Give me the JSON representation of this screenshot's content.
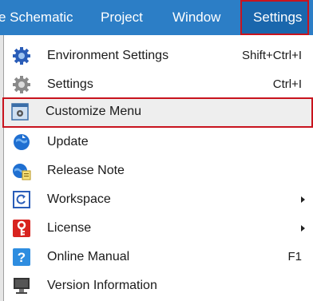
{
  "menubar": {
    "items": [
      "e Schematic",
      "Project",
      "Window",
      "Settings"
    ],
    "active": "Settings"
  },
  "dropdown": {
    "items": [
      {
        "label": "Environment Settings",
        "shortcut": "Shift+Ctrl+I",
        "icon": "gear-blue-icon"
      },
      {
        "label": "Settings",
        "shortcut": "Ctrl+I",
        "icon": "gear-gray-icon"
      },
      {
        "label": "Customize Menu",
        "shortcut": "",
        "icon": "customize-menu-icon",
        "highlighted": true
      },
      {
        "label": "Update",
        "shortcut": "",
        "icon": "globe-update-icon"
      },
      {
        "label": "Release Note",
        "shortcut": "",
        "icon": "release-note-icon"
      },
      {
        "label": "Workspace",
        "shortcut": "",
        "icon": "workspace-icon",
        "submenu": true
      },
      {
        "label": "License",
        "shortcut": "",
        "icon": "license-key-icon",
        "submenu": true
      },
      {
        "label": "Online Manual",
        "shortcut": "F1",
        "icon": "help-icon"
      },
      {
        "label": "Version Information",
        "shortcut": "",
        "icon": "version-monitor-icon"
      }
    ]
  },
  "colors": {
    "menubar_bg": "#2c7ec6",
    "highlight_border": "#c8141e",
    "highlight_bg": "#eeeeee"
  }
}
